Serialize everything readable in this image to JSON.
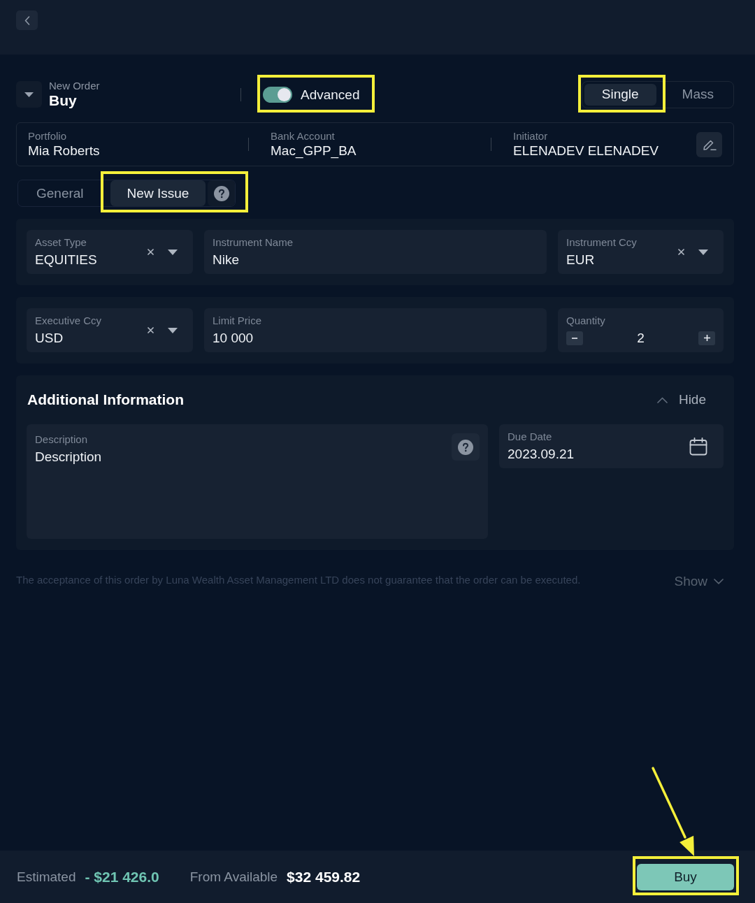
{
  "order": {
    "label": "New Order",
    "side": "Buy"
  },
  "advanced_toggle": {
    "label": "Advanced",
    "on": true,
    "highlighted": true
  },
  "modes": [
    {
      "label": "Single",
      "selected": true,
      "highlighted": true
    },
    {
      "label": "Mass",
      "selected": false,
      "highlighted": false
    }
  ],
  "info": [
    {
      "label": "Portfolio",
      "value": "Mia Roberts"
    },
    {
      "label": "Bank Account",
      "value": "Mac_GPP_BA"
    },
    {
      "label": "Initiator",
      "value": "ELENADEV ELENADEV"
    }
  ],
  "tabs": [
    {
      "label": "General",
      "selected": false,
      "highlighted": false
    },
    {
      "label": "New Issue",
      "selected": true,
      "highlighted": true
    }
  ],
  "field_rows": [
    [
      {
        "kind": "select",
        "label": "Asset Type",
        "value": "EQUITIES"
      },
      {
        "kind": "text",
        "label": "Instrument Name",
        "value": "Nike"
      },
      {
        "kind": "select",
        "label": "Instrument Ccy",
        "value": "EUR"
      }
    ],
    [
      {
        "kind": "select",
        "label": "Executive Ccy",
        "value": "USD"
      },
      {
        "kind": "text",
        "label": "Limit Price",
        "value": "10 000"
      },
      {
        "kind": "stepper",
        "label": "Quantity",
        "value": "2"
      }
    ]
  ],
  "additional_info": {
    "title": "Additional Information",
    "toggle_label": "Hide",
    "expanded": true,
    "fields": [
      {
        "kind": "textarea",
        "label": "Description",
        "value": "Description"
      },
      {
        "kind": "date",
        "label": "Due Date",
        "value": "2023.09.21"
      }
    ]
  },
  "disclaimer": {
    "text": "The acceptance of this order by Luna Wealth Asset Management LTD does not guarantee that the order can be executed.",
    "toggle_label": "Show",
    "expanded": false
  },
  "footer": {
    "estimated_label": "Estimated",
    "estimated_value": "- $21 426.0",
    "available_label": "From Available",
    "available_value": "$32 459.82",
    "buy_button": {
      "label": "Buy",
      "highlighted": true,
      "arrow": true
    }
  }
}
